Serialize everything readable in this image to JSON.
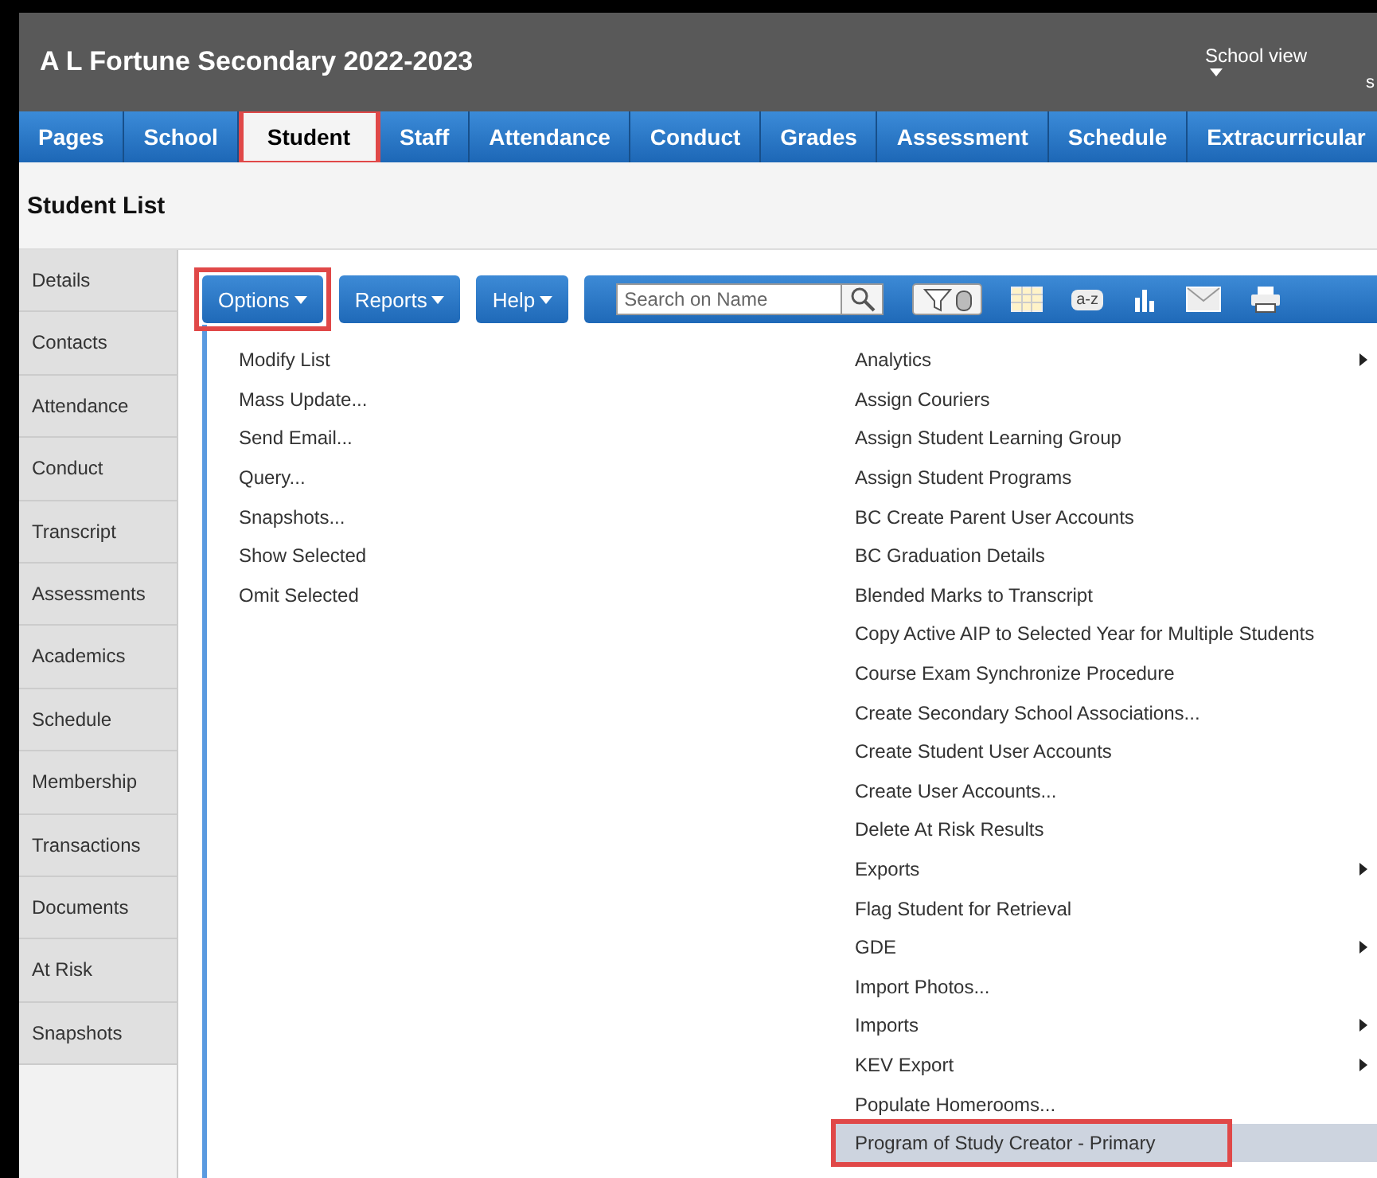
{
  "header": {
    "title": "A L Fortune Secondary 2022-2023",
    "view_menu": "School view",
    "user_label": "s"
  },
  "tabs": [
    {
      "label": "Pages",
      "selected": false,
      "highlighted": false
    },
    {
      "label": "School",
      "selected": false,
      "highlighted": false
    },
    {
      "label": "Student",
      "selected": true,
      "highlighted": true
    },
    {
      "label": "Staff",
      "selected": false,
      "highlighted": false
    },
    {
      "label": "Attendance",
      "selected": false,
      "highlighted": false
    },
    {
      "label": "Conduct",
      "selected": false,
      "highlighted": false
    },
    {
      "label": "Grades",
      "selected": false,
      "highlighted": false
    },
    {
      "label": "Assessment",
      "selected": false,
      "highlighted": false
    },
    {
      "label": "Schedule",
      "selected": false,
      "highlighted": false
    },
    {
      "label": "Extracurricular",
      "selected": false,
      "highlighted": false
    }
  ],
  "page_title": "Student List",
  "sidebar": {
    "items": [
      {
        "label": "Details",
        "selected": false
      },
      {
        "label": "Contacts",
        "selected": false
      },
      {
        "label": "Attendance",
        "selected": false
      },
      {
        "label": "Conduct",
        "selected": false
      },
      {
        "label": "Transcript",
        "selected": false
      },
      {
        "label": "Assessments",
        "selected": false
      },
      {
        "label": "Academics",
        "selected": false
      },
      {
        "label": "Schedule",
        "selected": false
      },
      {
        "label": "Membership",
        "selected": false
      },
      {
        "label": "Transactions",
        "selected": false
      },
      {
        "label": "Documents",
        "selected": false
      },
      {
        "label": "At Risk",
        "selected": false
      },
      {
        "label": "Snapshots",
        "selected": false
      }
    ]
  },
  "toolbar": {
    "menus": [
      {
        "label": "Options",
        "highlighted": true
      },
      {
        "label": "Reports",
        "highlighted": false
      },
      {
        "label": "Help",
        "highlighted": false
      }
    ],
    "search": {
      "placeholder": "Search on Name"
    },
    "tools": [
      {
        "kind": "filter"
      },
      {
        "kind": "grid"
      },
      {
        "kind": "sort",
        "label": "a-z"
      },
      {
        "kind": "chart"
      },
      {
        "kind": "mail"
      },
      {
        "kind": "print"
      }
    ]
  },
  "options_menu": {
    "left_items": [
      {
        "label": "Modify List"
      },
      {
        "label": "Mass Update..."
      },
      {
        "label": "Send Email..."
      },
      {
        "label": "Query..."
      },
      {
        "label": "Snapshots..."
      },
      {
        "label": "Show Selected"
      },
      {
        "label": "Omit Selected"
      }
    ],
    "right_items": [
      {
        "label": "Analytics",
        "submenu": true,
        "hovered": false,
        "highlighted": false
      },
      {
        "label": "Assign Couriers",
        "submenu": false,
        "hovered": false,
        "highlighted": false
      },
      {
        "label": "Assign Student Learning Group",
        "submenu": false,
        "hovered": false,
        "highlighted": false
      },
      {
        "label": "Assign Student Programs",
        "submenu": false,
        "hovered": false,
        "highlighted": false
      },
      {
        "label": "BC Create Parent User Accounts",
        "submenu": false,
        "hovered": false,
        "highlighted": false
      },
      {
        "label": "BC Graduation Details",
        "submenu": false,
        "hovered": false,
        "highlighted": false
      },
      {
        "label": "Blended Marks to Transcript",
        "submenu": false,
        "hovered": false,
        "highlighted": false
      },
      {
        "label": "Copy Active AIP to Selected Year for Multiple Students",
        "submenu": false,
        "hovered": false,
        "highlighted": false
      },
      {
        "label": "Course Exam Synchronize Procedure",
        "submenu": false,
        "hovered": false,
        "highlighted": false
      },
      {
        "label": "Create Secondary School Associations...",
        "submenu": false,
        "hovered": false,
        "highlighted": false
      },
      {
        "label": "Create Student User Accounts",
        "submenu": false,
        "hovered": false,
        "highlighted": false
      },
      {
        "label": "Create User Accounts...",
        "submenu": false,
        "hovered": false,
        "highlighted": false
      },
      {
        "label": "Delete At Risk Results",
        "submenu": false,
        "hovered": false,
        "highlighted": false
      },
      {
        "label": "Exports",
        "submenu": true,
        "hovered": false,
        "highlighted": false
      },
      {
        "label": "Flag Student for Retrieval",
        "submenu": false,
        "hovered": false,
        "highlighted": false
      },
      {
        "label": "GDE",
        "submenu": true,
        "hovered": false,
        "highlighted": false
      },
      {
        "label": "Import Photos...",
        "submenu": false,
        "hovered": false,
        "highlighted": false
      },
      {
        "label": "Imports",
        "submenu": true,
        "hovered": false,
        "highlighted": false
      },
      {
        "label": "KEV Export",
        "submenu": true,
        "hovered": false,
        "highlighted": false
      },
      {
        "label": "Populate Homerooms...",
        "submenu": false,
        "hovered": false,
        "highlighted": false
      },
      {
        "label": "Program of Study Creator - Primary",
        "submenu": false,
        "hovered": true,
        "highlighted": true
      }
    ]
  }
}
